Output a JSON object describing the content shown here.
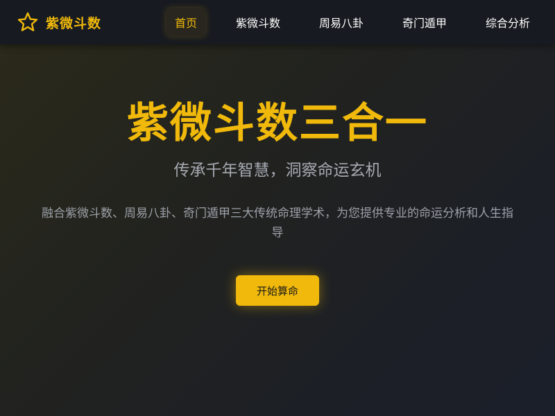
{
  "brand": {
    "icon": "star-outline-icon",
    "name": "紫微斗数"
  },
  "nav": {
    "items": [
      {
        "label": "首页",
        "active": true
      },
      {
        "label": "紫微斗数",
        "active": false
      },
      {
        "label": "周易八卦",
        "active": false
      },
      {
        "label": "奇门遁甲",
        "active": false
      },
      {
        "label": "综合分析",
        "active": false
      }
    ]
  },
  "hero": {
    "title": "紫微斗数三合一",
    "subtitle": "传承千年智慧，洞察命运玄机",
    "description": "融合紫微斗数、周易八卦、奇门遁甲三大传统命理学术，为您提供专业的命运分析和人生指导",
    "cta_label": "开始算命"
  },
  "colors": {
    "accent": "#f0b90b",
    "navbar_bg": "#171a20",
    "text_muted": "#a6a9b1"
  }
}
